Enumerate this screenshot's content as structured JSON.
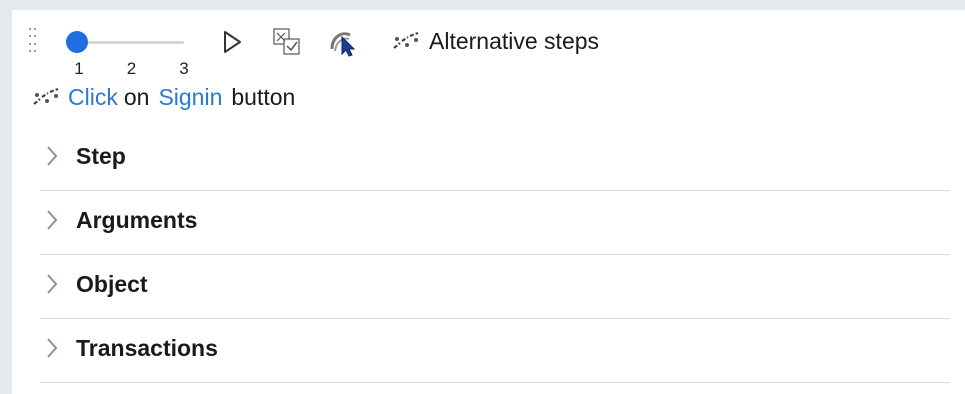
{
  "toolbar": {
    "slider": {
      "ticks": [
        "1",
        "2",
        "3"
      ],
      "value": 1
    },
    "icons": [
      "drag-grip-icon",
      "play-icon",
      "compare-steps-icon",
      "edit-object-icon",
      "alternative-steps-icon"
    ],
    "alternative_steps_label": "Alternative steps"
  },
  "step": {
    "parts": [
      "Click",
      "on",
      "Signin",
      "button"
    ],
    "highlight_color": "#2a78d6"
  },
  "sections": [
    {
      "label": "Step"
    },
    {
      "label": "Arguments"
    },
    {
      "label": "Object"
    },
    {
      "label": "Transactions"
    }
  ],
  "colors": {
    "accent": "#1f6fe0",
    "link": "#2a78d6",
    "divider": "#d9dcdf"
  }
}
